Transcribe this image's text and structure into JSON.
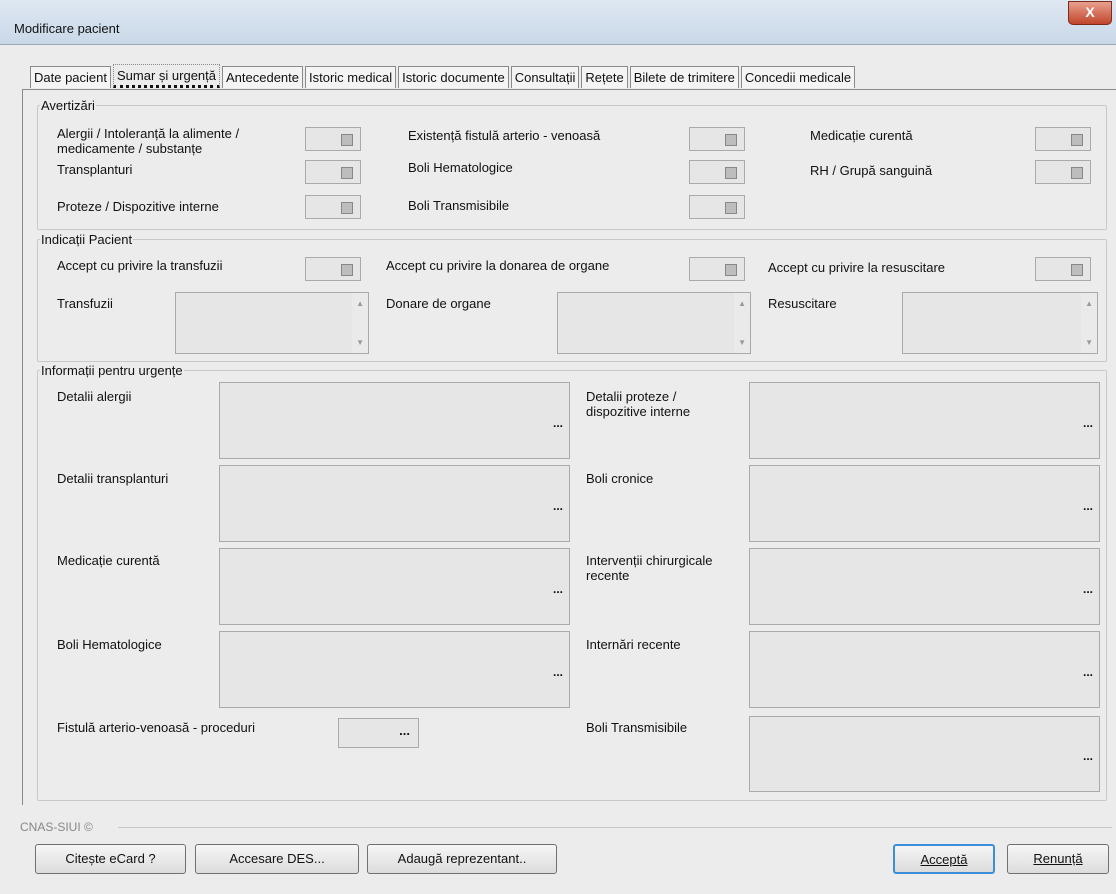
{
  "window": {
    "title": "Modificare pacient",
    "close_glyph": "X"
  },
  "tabs": [
    "Date pacient",
    "Sumar și urgență",
    "Antecedente",
    "Istoric medical",
    "Istoric documente",
    "Consultații",
    "Rețete",
    "Bilete de trimitere",
    "Concedii medicale"
  ],
  "active_tab": "Sumar și urgență",
  "avertizari": {
    "legend": "Avertizări",
    "alergii": "Alergii / Intoleranță la alimente / medicamente / substanțe",
    "transplanturi": "Transplanturi",
    "proteze": "Proteze / Dispozitive interne",
    "fistula": "Existență fistulă arterio - venoasă",
    "hematologice": "Boli Hematologice",
    "transmisibile": "Boli Transmisibile",
    "medicatie": "Medicație curentă",
    "rh": "RH / Grupă sanguină"
  },
  "indicatii": {
    "legend": "Indicații Pacient",
    "accept_transfuzii": "Accept cu privire la transfuzii",
    "accept_organe": "Accept cu privire la donarea de organe",
    "accept_resuscitare": "Accept cu privire la resuscitare",
    "transfuzii": "Transfuzii",
    "donare": "Donare de organe",
    "resuscitare": "Resuscitare"
  },
  "urgente": {
    "legend": "Informații pentru urgențe",
    "detalii_alergii": "Detalii alergii",
    "detalii_proteze": "Detalii proteze / dispozitive interne",
    "detalii_transplanturi": "Detalii transplanturi",
    "boli_cronice": "Boli cronice",
    "medicatie": "Medicație curentă",
    "interventii": "Intervenții chirurgicale recente",
    "hematologice": "Boli Hematologice",
    "internari": "Internări recente",
    "fistula_proceduri": "Fistulă arterio-venoasă - proceduri",
    "transmisibile": "Boli Transmisibile",
    "ellipsis": "..."
  },
  "footer": {
    "label": "CNAS-SIUI ©",
    "citeste": "Citește eCard ?",
    "accesare": "Accesare DES...",
    "adauga": "Adaugă reprezentant..",
    "accepta": "Acceptă",
    "renunta": "Renunță"
  }
}
